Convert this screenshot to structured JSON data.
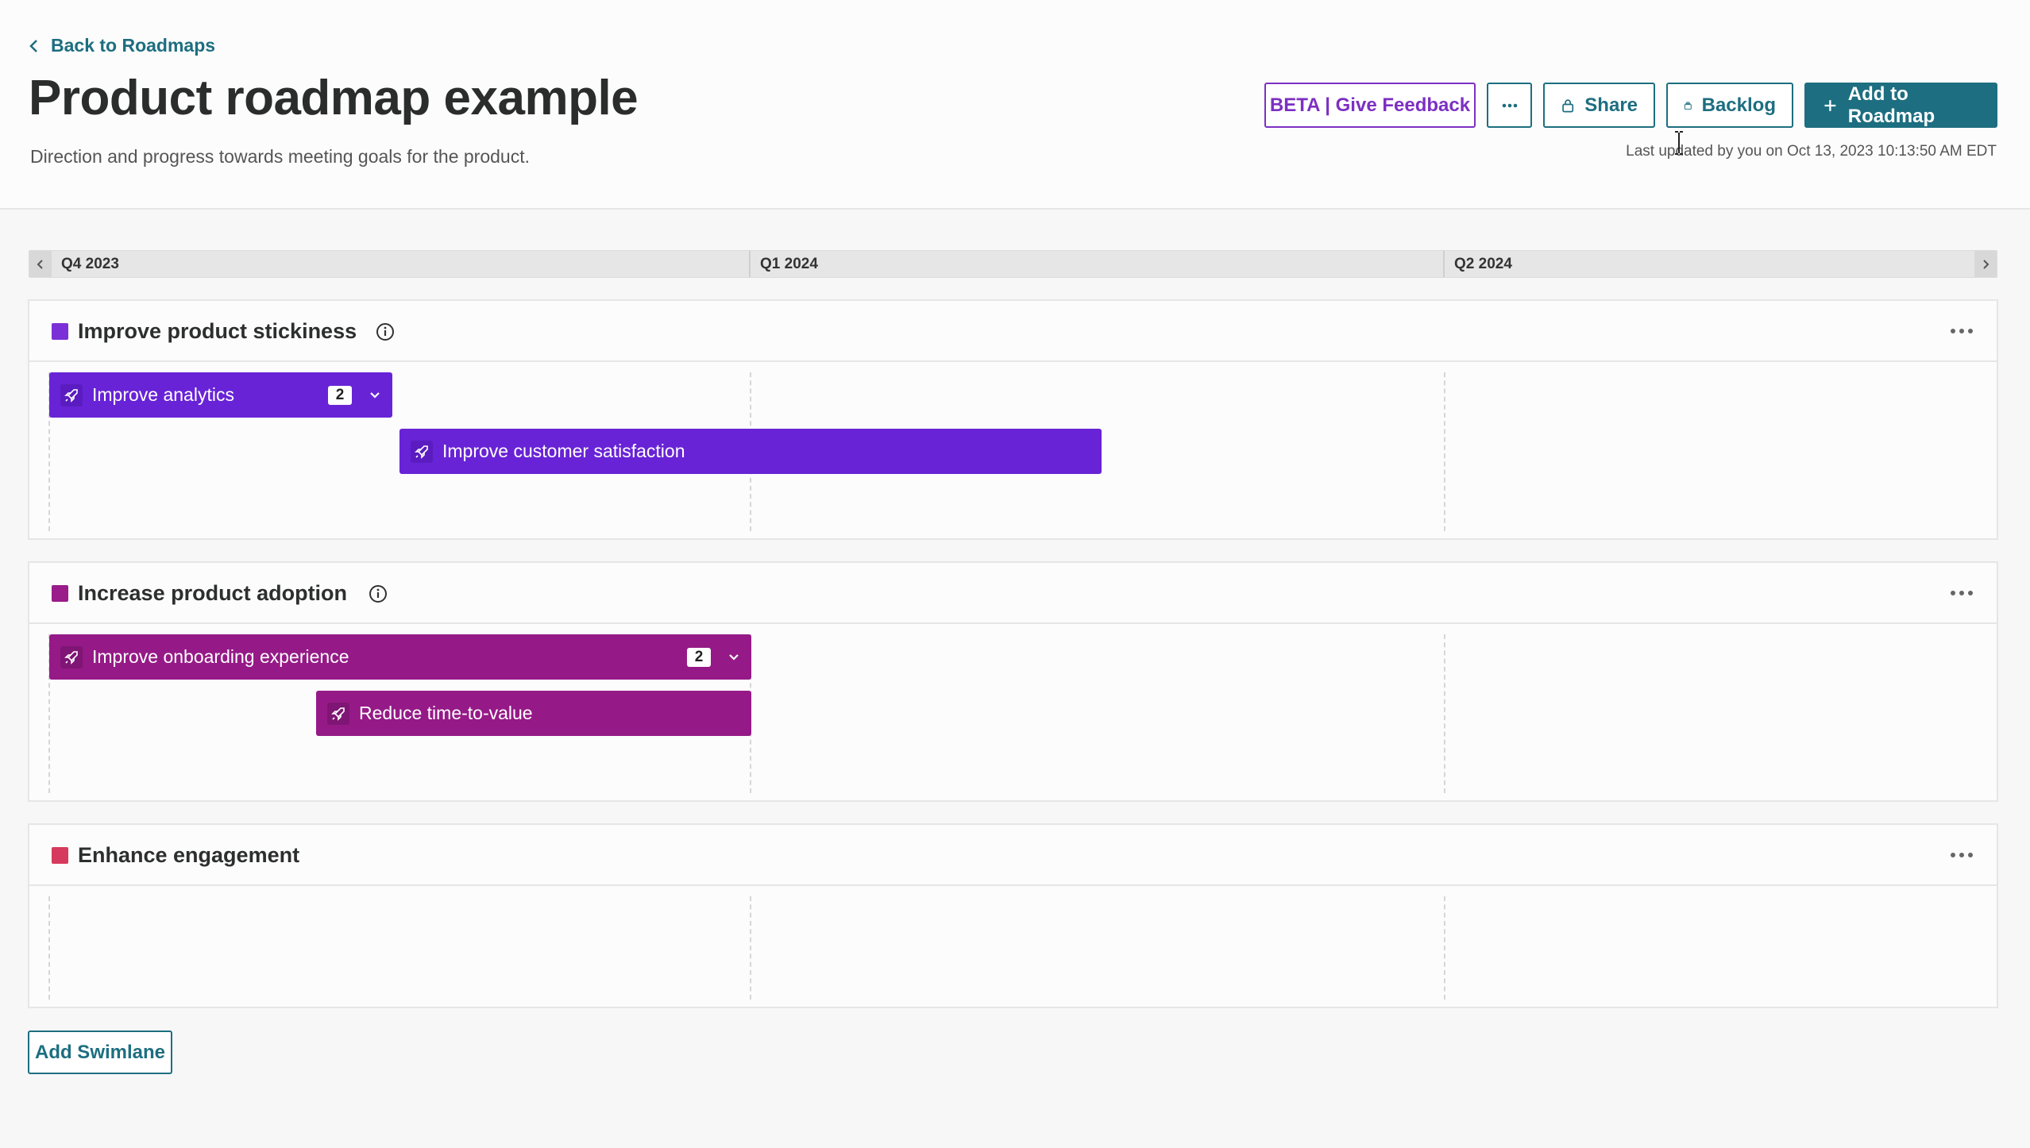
{
  "header": {
    "back_link": "Back to Roadmaps",
    "title": "Product roadmap example",
    "description": "Direction and progress towards meeting goals for the product.",
    "last_updated": "Last updated by you on Oct 13, 2023 10:13:50 AM EDT"
  },
  "actions": {
    "beta": "BETA | Give Feedback",
    "share": "Share",
    "backlog": "Backlog",
    "add": "Add to Roadmap"
  },
  "timeline": {
    "quarters": [
      "Q4 2023",
      "Q1 2024",
      "Q2 2024"
    ]
  },
  "swimlanes": [
    {
      "title": "Improve product stickiness",
      "color": "#7a30d6",
      "items": [
        {
          "label": "Improve analytics",
          "count": "2"
        },
        {
          "label": "Improve customer satisfaction"
        }
      ]
    },
    {
      "title": "Increase product adoption",
      "color": "#9a1b8a",
      "items": [
        {
          "label": "Improve onboarding experience",
          "count": "2"
        },
        {
          "label": "Reduce time-to-value"
        }
      ]
    },
    {
      "title": "Enhance engagement",
      "color": "#d63a5c",
      "items": []
    }
  ],
  "footer": {
    "add_swimlane": "Add Swimlane"
  },
  "colors": {
    "accent": "#1d6e80",
    "beta": "#7d2fc2",
    "bar_purple": "#6823d6",
    "bar_magenta": "#951a87"
  },
  "icons": [
    "chevron-left-icon",
    "lock-icon",
    "backlog-icon",
    "plus-icon",
    "more-icon",
    "info-icon",
    "rocket-icon",
    "chevron-down-icon",
    "chevron-right-icon",
    "text-cursor-icon"
  ]
}
